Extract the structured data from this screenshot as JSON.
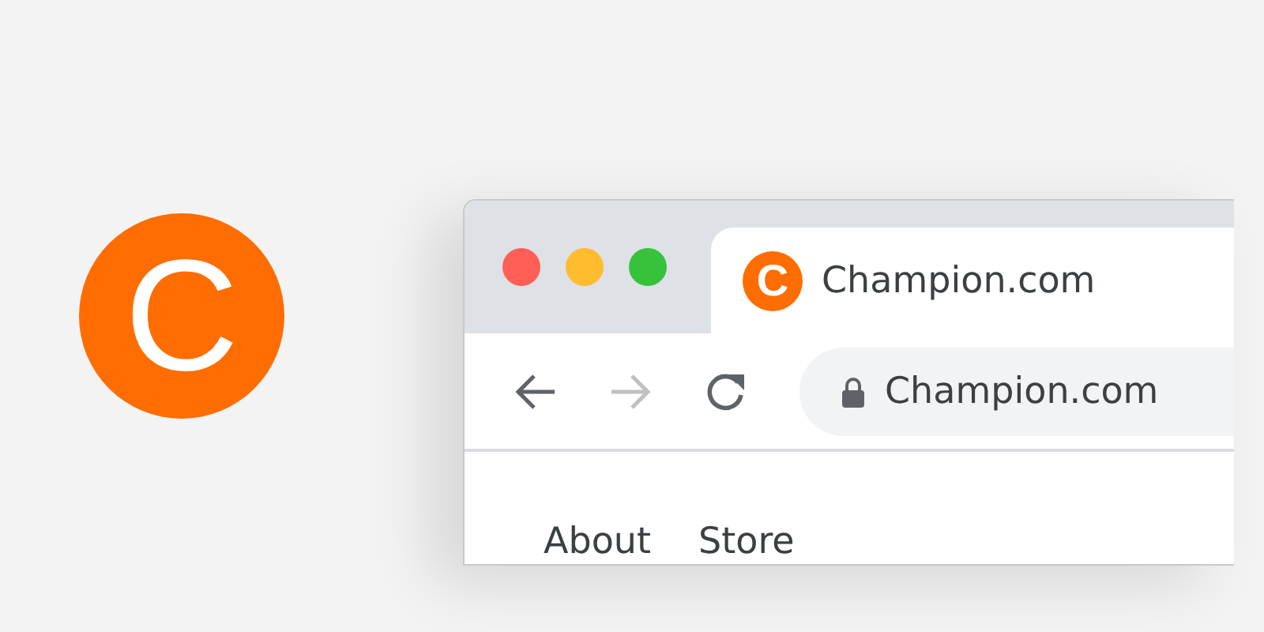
{
  "logo": {
    "letter": "C"
  },
  "window": {
    "controls": [
      {
        "color": "#ff5f57"
      },
      {
        "color": "#febc2e"
      },
      {
        "color": "#37c23c"
      }
    ]
  },
  "tab": {
    "favicon": "C",
    "title": "Champion.com",
    "selected": true
  },
  "toolbar": {
    "back": {
      "disabled": false
    },
    "forward": {
      "disabled": true
    },
    "address": "Champion.com"
  },
  "nav": [
    {
      "label": "About"
    },
    {
      "label": "Store"
    }
  ]
}
